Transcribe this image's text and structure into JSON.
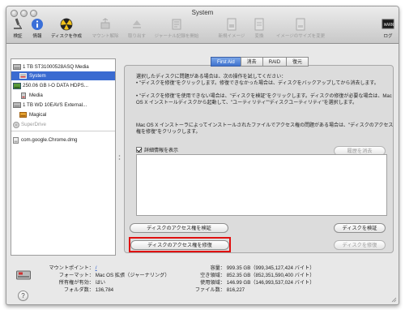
{
  "window": {
    "title": "System"
  },
  "toolbar": {
    "verify": "検証",
    "info": "情報",
    "burn": "ディスクを作成",
    "mount": "マウント解除",
    "eject": "取り出す",
    "enable_journal": "ジャーナル記録を開始",
    "new_image": "新規イメージ",
    "convert": "変換",
    "resize_image": "イメージのサイズを変更",
    "log": "ログ"
  },
  "sidebar": {
    "items": [
      {
        "label": "1 TB ST31000528ASQ Media",
        "icon": "hard-disk-icon"
      },
      {
        "label": "System",
        "icon": "volume-icon"
      },
      {
        "label": "250.06 GB I-O DATA HDPS...",
        "icon": "external-disk-icon"
      },
      {
        "label": "Media",
        "icon": "volume-icon"
      },
      {
        "label": "1 TB WD 10EAVS External...",
        "icon": "hard-disk-icon"
      },
      {
        "label": "Magical",
        "icon": "volume-icon"
      },
      {
        "label": "SuperDrive",
        "icon": "optical-drive-icon"
      },
      {
        "label": "com.google.Chrome.dmg",
        "icon": "disk-image-icon"
      }
    ]
  },
  "tabs": [
    "First Aid",
    "消去",
    "RAID",
    "復元"
  ],
  "first_aid": {
    "intro": "選択したディスクに問題がある場合は、次の操作を試してください：",
    "bullet1": "• \"ディスクを修復\"をクリックします。修復できなかった場合は、ディスクをバックアップしてから消去します。",
    "bullet2": "• \"ディスクを修復\"を使用できない場合は、\"ディスクを検証\"をクリックします。ディスクの修復が必要な場合は、Mac OS X インストールディスクから起動して、\"ユーティリティ\"\"ディスクユーティリティ\"を選択します。",
    "permissions_note": "Mac OS X インストーラによってインストールされたファイルでアクセス権の問題がある場合は、\"ディスクのアクセス権を修復\"をクリックします。",
    "show_details": "詳細情報を表示",
    "clear_history": "履歴を消去",
    "verify_permissions": "ディスクのアクセス権を検証",
    "repair_permissions": "ディスクのアクセス権を修復",
    "verify_disk": "ディスクを検証",
    "repair_disk": "ディスクを修復"
  },
  "info_left": [
    {
      "key": "マウントポイント：",
      "value": "/"
    },
    {
      "key": "フォーマット：",
      "value": "Mac OS 拡張（ジャーナリング）"
    },
    {
      "key": "所有権が有効：",
      "value": "はい"
    },
    {
      "key": "フォルダ数：",
      "value": "136,784"
    }
  ],
  "info_right": [
    {
      "key": "容量：",
      "value": "999.35 GB（999,345,127,424 バイト）"
    },
    {
      "key": "空き領域：",
      "value": "852.35 GB（852,351,590,400 バイト）"
    },
    {
      "key": "使用領域：",
      "value": "146.99 GB（146,993,537,024 バイト）"
    },
    {
      "key": "ファイル数：",
      "value": "816,227"
    }
  ],
  "help": "?"
}
